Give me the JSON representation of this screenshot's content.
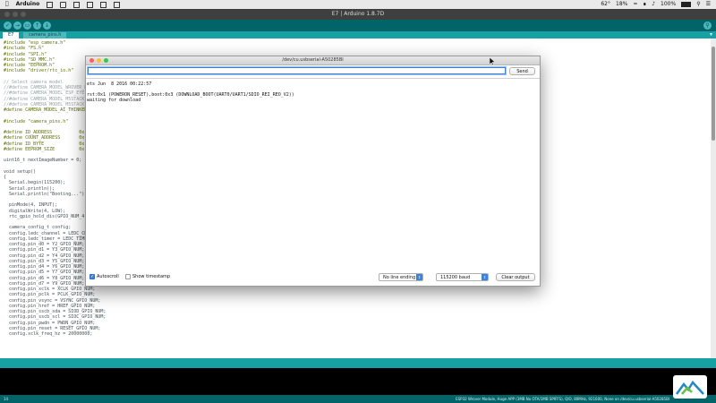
{
  "menubar": {
    "app": "Arduino",
    "battery": "100%",
    "temperature": "62°",
    "cpu": "18%"
  },
  "window": {
    "title": "E7 | Arduino 1.8.7D"
  },
  "tabs": [
    {
      "label": "E7"
    },
    {
      "label": "camera_pins.h"
    }
  ],
  "editor": {
    "lines": [
      "#include \"esp_camera.h\"",
      "#include \"FS.h\"",
      "#include \"SPI.h\"",
      "#include \"SD_MMC.h\"",
      "#include \"EEPROM.h\"",
      "#include \"driver/rtc_io.h\"",
      "",
      "// Select camera model",
      "//#define CAMERA_MODEL_WROVER_K",
      "//#define CAMERA_MODEL_ESP_EYE",
      "//#define CAMERA_MODEL_M5STACK_",
      "//#define CAMERA_MODEL_M5STACK_",
      "#define CAMERA_MODEL_AI_THINKER",
      "",
      "#include \"camera_pins.h\"",
      "",
      "#define ID_ADDRESS          0x",
      "#define COUNT_ADDRESS       0x",
      "#define ID_BYTE             0x",
      "#define EEPROM_SIZE         0x",
      "",
      "uint16_t nextImageNumber = 0;",
      "",
      "void setup()",
      "{",
      "  Serial.begin(115200);",
      "  Serial.println();",
      "  Serial.println(\"Booting...\");",
      "",
      "  pinMode(4, INPUT);",
      "  digitalWrite(4, LOW);",
      "  rtc_gpio_hold_dis(GPIO_NUM_4);",
      "",
      "  camera_config_t config;",
      "  config.ledc_channel = LEDC_CHA",
      "  config.ledc_timer = LEDC_TIMER",
      "  config.pin_d0 = Y2_GPIO_NUM;",
      "  config.pin_d1 = Y3_GPIO_NUM;",
      "  config.pin_d2 = Y4_GPIO_NUM;",
      "  config.pin_d3 = Y5_GPIO_NUM;",
      "  config.pin_d4 = Y6_GPIO_NUM;",
      "  config.pin_d5 = Y7_GPIO_NUM;",
      "  config.pin_d6 = Y8_GPIO_NUM;",
      "  config.pin_d7 = Y9_GPIO_NUM;",
      "  config.pin_xclk = XCLK_GPIO_NUM;",
      "  config.pin_pclk = PCLK_GPIO_NUM;",
      "  config.pin_vsync = VSYNC_GPIO_NUM;",
      "  config.pin_href = HREF_GPIO_NUM;",
      "  config.pin_sscb_sda = SIOD_GPIO_NUM;",
      "  config.pin_sscb_scl = SIOC_GPIO_NUM;",
      "  config.pin_pwdn = PWDN_GPIO_NUM;",
      "  config.pin_reset = RESET_GPIO_NUM;",
      "  config.xclk_freq_hz = 20000000;"
    ]
  },
  "monitor": {
    "title": "/dev/cu.usbserial-A50285BI",
    "input_value": "",
    "send_label": "Send",
    "output": [
      "ets Jun  8 2016 00:22:57",
      "",
      "rst:0x1 (POWERON_RESET),boot:0x3 (DOWNLOAD_BOOT(UART0/UART1/SDIO_REI_REO_V2))",
      "waiting for download"
    ],
    "autoscroll_label": "Autoscroll",
    "autoscroll_checked": true,
    "timestamp_label": "Show timestamp",
    "timestamp_checked": false,
    "line_ending": "No line ending",
    "baud": "115200 baud",
    "clear_label": "Clear output"
  },
  "status": {
    "line_number": "14",
    "board": "ESP32 Wrover Module, Huge APP (3MB No OTA/1MB SPIFFS), QIO, 80MHz, 921600, None on /dev/cu.usbserial-A50285BI"
  },
  "colors": {
    "arduino_dark": "#006468",
    "arduino_teal": "#17a1a5",
    "accent_blue": "#3b82d8"
  }
}
